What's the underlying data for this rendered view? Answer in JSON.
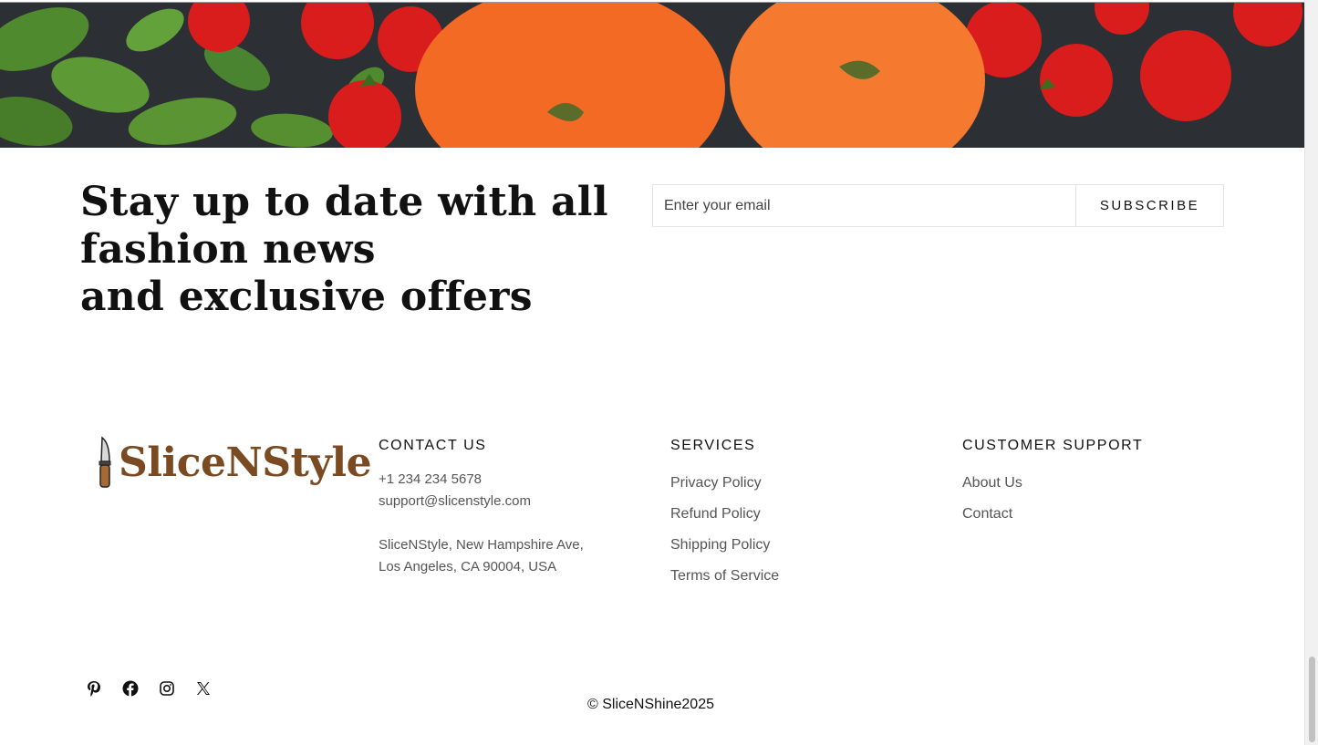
{
  "newsletter": {
    "heading_line1": "Stay up to date with all fashion news",
    "heading_line2": "and exclusive offers",
    "email_placeholder": "Enter your email",
    "subscribe_label": "SUBSCRIBE"
  },
  "brand": {
    "name": "SliceNStyle",
    "color": "#7a4a22"
  },
  "footer": {
    "contact": {
      "title": "CONTACT US",
      "phone": "+1 234 234 5678",
      "email": "support@slicenstyle.com",
      "address_line1": "SliceNStyle,  New Hampshire Ave,",
      "address_line2": "Los Angeles, CA 90004, USA"
    },
    "services": {
      "title": "SERVICES",
      "links": [
        "Privacy Policy",
        "Refund Policy",
        "Shipping Policy",
        "Terms of Service"
      ]
    },
    "support": {
      "title": "CUSTOMER SUPPORT",
      "links": [
        "About Us",
        "Contact"
      ]
    },
    "socials": [
      "pinterest-icon",
      "facebook-icon",
      "instagram-icon",
      "x-twitter-icon"
    ],
    "copyright": "© SliceNShine2025"
  }
}
